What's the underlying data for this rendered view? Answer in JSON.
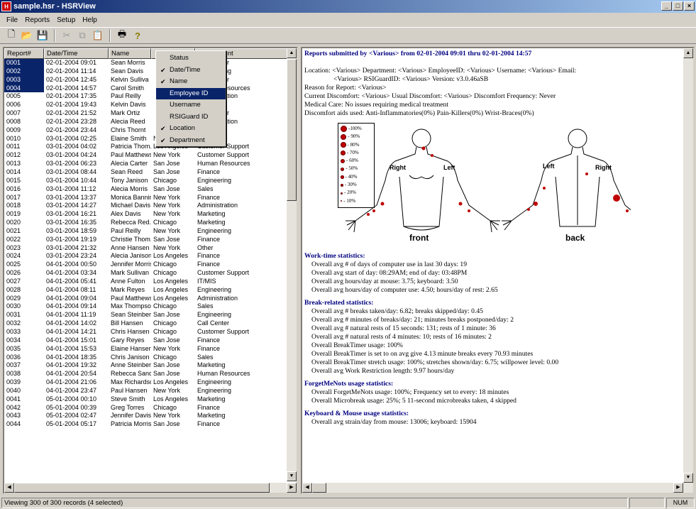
{
  "window": {
    "title": "sample.hsr - HSRView"
  },
  "menu": [
    "File",
    "Reports",
    "Setup",
    "Help"
  ],
  "columns": [
    "Report#",
    "Date/Time",
    "Name",
    "",
    "Department"
  ],
  "rows": [
    [
      "0001",
      "02-01-2004 09:01",
      "Sean Morris",
      "",
      "Call Center"
    ],
    [
      "0002",
      "02-01-2004 11:14",
      "Sean Davis",
      "",
      "Engineering"
    ],
    [
      "0003",
      "02-01-2004 12:45",
      "Kelvin Sulliva",
      "",
      "Call Center"
    ],
    [
      "0004",
      "02-01-2004 14:57",
      "Carol Smith",
      "",
      "Human Resources"
    ],
    [
      "0005",
      "02-01-2004 17:35",
      "Paul Reilly",
      "",
      "Administration"
    ],
    [
      "0006",
      "02-01-2004 19:43",
      "Kelvin Davis",
      "",
      "Sales"
    ],
    [
      "0007",
      "02-01-2004 21:52",
      "Mark Ortiz",
      "",
      "Call Center"
    ],
    [
      "0008",
      "02-01-2004 23:28",
      "Alecia Reed",
      "",
      "Administration"
    ],
    [
      "0009",
      "02-01-2004 23:44",
      "Chris Thornt",
      "",
      "Finance"
    ],
    [
      "0010",
      "03-01-2004 02:25",
      "Elaine Smith",
      "New York",
      "Finance"
    ],
    [
      "0011",
      "03-01-2004 04:02",
      "Patricia Thom...",
      "Los Angeles",
      "Customer Support"
    ],
    [
      "0012",
      "03-01-2004 04:24",
      "Paul Matthews",
      "New York",
      "Customer Support"
    ],
    [
      "0013",
      "03-01-2004 06:23",
      "Alecia Carter",
      "San Jose",
      "Human Resources"
    ],
    [
      "0014",
      "03-01-2004 08:44",
      "Sean Reed",
      "San Jose",
      "Finance"
    ],
    [
      "0015",
      "03-01-2004 10:44",
      "Tony Janison",
      "Chicago",
      "Engineering"
    ],
    [
      "0016",
      "03-01-2004 11:12",
      "Alecia Morris",
      "San Jose",
      "Sales"
    ],
    [
      "0017",
      "03-01-2004 13:37",
      "Monica Banning",
      "New York",
      "Finance"
    ],
    [
      "0018",
      "03-01-2004 14:27",
      "Michael Davis",
      "New York",
      "Administration"
    ],
    [
      "0019",
      "03-01-2004 16:21",
      "Alex Davis",
      "New York",
      "Marketing"
    ],
    [
      "0020",
      "03-01-2004 16:35",
      "Rebecca Red...",
      "Chicago",
      "Marketing"
    ],
    [
      "0021",
      "03-01-2004 18:59",
      "Paul Reilly",
      "New York",
      "Engineering"
    ],
    [
      "0022",
      "03-01-2004 19:19",
      "Christie Thom...",
      "San Jose",
      "Finance"
    ],
    [
      "0023",
      "03-01-2004 21:32",
      "Anne Hansen",
      "New York",
      "Other"
    ],
    [
      "0024",
      "03-01-2004 23:24",
      "Alecia Janison",
      "Los Angeles",
      "Finance"
    ],
    [
      "0025",
      "04-01-2004 00:50",
      "Jennifer Morris",
      "Chicago",
      "Finance"
    ],
    [
      "0026",
      "04-01-2004 03:34",
      "Mark Sullivan",
      "Chicago",
      "Customer Support"
    ],
    [
      "0027",
      "04-01-2004 05:41",
      "Anne Fulton",
      "Los Angeles",
      "IT/MIS"
    ],
    [
      "0028",
      "04-01-2004 08:11",
      "Mark Reyes",
      "Los Angeles",
      "Engineering"
    ],
    [
      "0029",
      "04-01-2004 09:04",
      "Paul Matthews",
      "Los Angeles",
      "Administration"
    ],
    [
      "0030",
      "04-01-2004 09:14",
      "Max Thompson",
      "Chicago",
      "Sales"
    ],
    [
      "0031",
      "04-01-2004 11:19",
      "Sean Steinberg",
      "San Jose",
      "Engineering"
    ],
    [
      "0032",
      "04-01-2004 14:02",
      "Bill Hansen",
      "Chicago",
      "Call Center"
    ],
    [
      "0033",
      "04-01-2004 14:21",
      "Chris Hansen",
      "Chicago",
      "Customer Support"
    ],
    [
      "0034",
      "04-01-2004 15:01",
      "Gary Reyes",
      "San Jose",
      "Finance"
    ],
    [
      "0035",
      "04-01-2004 15:53",
      "Elaine Hansen",
      "New York",
      "Finance"
    ],
    [
      "0036",
      "04-01-2004 18:35",
      "Chris Janison",
      "Chicago",
      "Sales"
    ],
    [
      "0037",
      "04-01-2004 19:32",
      "Anne Steinberg",
      "San Jose",
      "Marketing"
    ],
    [
      "0038",
      "04-01-2004 20:54",
      "Rebecca Sanc...",
      "San Jose",
      "Human Resources"
    ],
    [
      "0039",
      "04-01-2004 21:06",
      "Max Richardson",
      "Los Angeles",
      "Engineering"
    ],
    [
      "0040",
      "04-01-2004 23:47",
      "Paul Hansen",
      "New York",
      "Engineering"
    ],
    [
      "0041",
      "05-01-2004 00:10",
      "Steve Smith",
      "Los Angeles",
      "Marketing"
    ],
    [
      "0042",
      "05-01-2004 00:39",
      "Greg Torres",
      "Chicago",
      "Finance"
    ],
    [
      "0043",
      "05-01-2004 02:47",
      "Jennifer Davis",
      "New York",
      "Marketing"
    ],
    [
      "0044",
      "05-01-2004 05:17",
      "Patricia Morris",
      "San Jose",
      "Finance"
    ]
  ],
  "selected_rows": 4,
  "context_menu": [
    {
      "label": "Status",
      "checked": false,
      "highlight": false
    },
    {
      "label": "Date/Time",
      "checked": true,
      "highlight": false
    },
    {
      "label": "Name",
      "checked": true,
      "highlight": false
    },
    {
      "label": "Employee ID",
      "checked": false,
      "highlight": true
    },
    {
      "label": "Username",
      "checked": false,
      "highlight": false
    },
    {
      "label": "RSIGuard ID",
      "checked": false,
      "highlight": false
    },
    {
      "label": "Location",
      "checked": true,
      "highlight": false
    },
    {
      "label": "Department",
      "checked": true,
      "highlight": false
    }
  ],
  "report": {
    "heading": "Reports submitted by <Various> from 02-01-2004 09:01 thru 02-01-2004 14:57",
    "location_line": "Location: <Various>   Department: <Various>   EmployeeID: <Various>   Username: <Various>   Email:",
    "location_line2": "<Various>   RSIGuardID: <Various>   Version: v3.0.46aSB",
    "reason": "Reason for Report: <Various>",
    "discomfort": "Current Discomfort: <Various>   Usual Discomfort: <Various>   Discomfort Frequency: Never",
    "medical": "Medical Care: No issues requiring medical treatment",
    "aids": "Discomfort aids used: Anti-Inflammatories(0%) Pain-Killers(0%) Wrist-Braces(0%)",
    "legend": [
      "-100%",
      "- 90%",
      "- 80%",
      "- 70%",
      "- 60%",
      "- 50%",
      "- 40%",
      "- 30%",
      "- 20%",
      "- 10%"
    ],
    "front_label": "front",
    "back_label": "back",
    "front_right": "Right",
    "front_left": "Left",
    "back_left": "Left",
    "back_right": "Right",
    "work_h": "Work-time statistics:",
    "work": [
      "Overall avg # of days of computer use in last 30 days: 19",
      "Overall avg start of day: 08:29AM;    end of day: 03:48PM",
      "Overall avg hours/day at mouse: 3.75;    keyboard: 3.50",
      "Overall avg hours/day of computer use: 4.50;    hours/day of rest: 2.65"
    ],
    "break_h": "Break-related statistics:",
    "breaks": [
      "Overall avg # breaks taken/day: 6.82;    breaks skipped/day: 0.45",
      "Overall avg # minutes of breaks/day: 21;    minutes breaks postponed/day: 2",
      "Overall avg # natural rests of 15 seconds: 131;    rests of 1 minute: 36",
      "Overall avg # natural rests of 4 minutes: 10;    rests of 16 minutes: 2",
      "Overall BreakTimer usage: 100%",
      "Overall BreakTimer is set to on avg give 4.13 minute breaks every 70.93 minutes",
      "Overall BreakTimer stretch usage: 100%;    stretches shown/day: 6.75;    willpower level: 0.00",
      "Overall avg Work Restriction length: 9.97 hours/day"
    ],
    "forget_h": "ForgetMeNots usage statistics:",
    "forget": [
      "Overall ForgetMeNots usage: 100%;    Frequency set to every: 18 minutes",
      "Overall Microbreak usage: 25%;    5 11-second microbreaks taken, 4 skipped"
    ],
    "kb_h": "Keyboard & Mouse usage statistics:",
    "kb": [
      "Overall avg strain/day from mouse: 13006;    keyboard: 15904"
    ]
  },
  "status": {
    "text": "Viewing 300 of 300 records (4 selected)",
    "num": "NUM"
  },
  "colors": {
    "selection": "#0a246a",
    "heading": "#000080",
    "marker": "#c00000"
  }
}
